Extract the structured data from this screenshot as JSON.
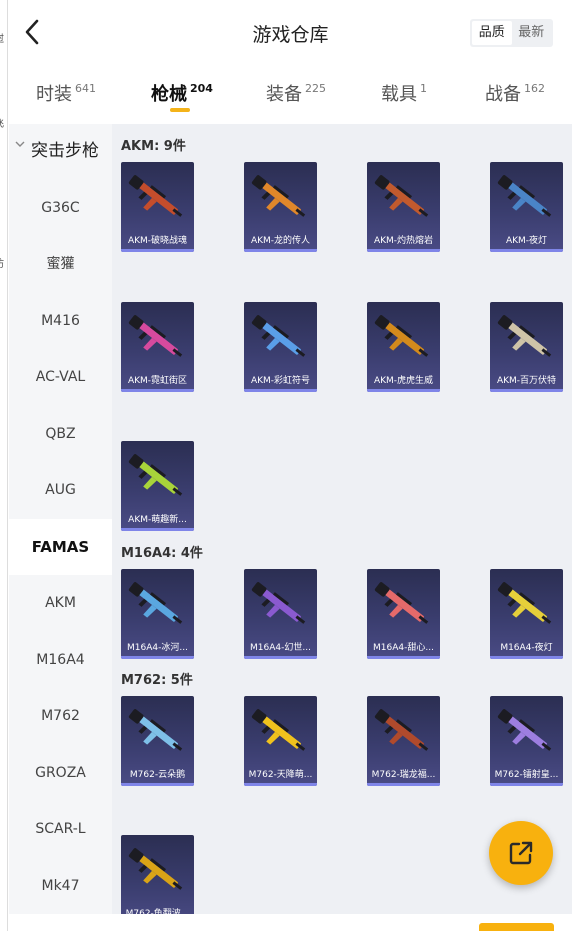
{
  "header": {
    "title": "游戏仓库",
    "sort_options": [
      "品质",
      "最新"
    ],
    "active_sort": 0
  },
  "tabs": [
    {
      "label": "时装",
      "count": "641"
    },
    {
      "label": "枪械",
      "count": "204"
    },
    {
      "label": "装备",
      "count": "225"
    },
    {
      "label": "载具",
      "count": "1"
    },
    {
      "label": "战备",
      "count": "162"
    }
  ],
  "active_tab": 1,
  "sidebar": {
    "category": "突击步枪",
    "items": [
      "G36C",
      "蜜獾",
      "M416",
      "AC-VAL",
      "QBZ",
      "AUG",
      "FAMAS",
      "AKM",
      "M16A4",
      "M762",
      "GROZA",
      "SCAR-L",
      "Mk47"
    ],
    "active_item": 6
  },
  "sections": [
    {
      "title": "AKM: 9件",
      "items": [
        "AKM-破晓战魂",
        "AKM-龙的传人",
        "AKM-灼热熔岩",
        "AKM-夜灯",
        "AKM-霓虹街区",
        "AKM-彩虹符号",
        "AKM-虎虎生威",
        "AKM-百万伏特",
        "AKM-萌趣新..."
      ]
    },
    {
      "title": "M16A4: 4件",
      "items": [
        "M16A4-冰河...",
        "M16A4-幻世...",
        "M16A4-甜心...",
        "M16A4-夜灯"
      ]
    },
    {
      "title": "M762: 5件",
      "items": [
        "M762-云朵鹅",
        "M762-天降萌...",
        "M762-瑞龙福...",
        "M762-镭射皇...",
        "M762-鱼翻波..."
      ]
    }
  ],
  "colors": {
    "accent": "#f8b10e",
    "card_bg": "#3a3d6e",
    "card_bar": "#7f85e8",
    "gun_colors": [
      "#c44d2c",
      "#e0872a",
      "#c15a2e",
      "#4a84c7",
      "#d64a9e",
      "#5a9ee8",
      "#d38a1c",
      "#cfc4a8",
      "#a8d43a",
      "#5aa7e0",
      "#8a5ad0",
      "#e56a6a",
      "#e6cf3a",
      "#7ec0e8",
      "#f0c21d",
      "#b04a2c",
      "#9d7ee0",
      "#d9a417"
    ]
  },
  "icons": {
    "back": "chevron-left-icon",
    "fab": "share-external-icon"
  }
}
